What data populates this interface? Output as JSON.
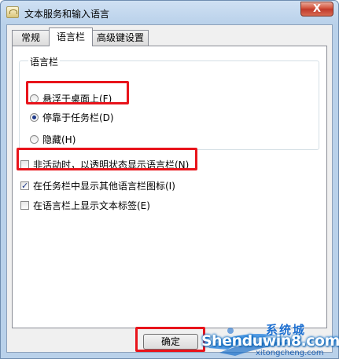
{
  "window": {
    "title": "文本服务和输入语言",
    "close_label": "X"
  },
  "tabs": [
    {
      "label": "常规",
      "active": false
    },
    {
      "label": "语言栏",
      "active": true
    },
    {
      "label": "高级键设置",
      "active": false
    }
  ],
  "language_bar_group": {
    "label": "语言栏",
    "options": [
      {
        "label": "悬浮于桌面上(F)",
        "selected": false
      },
      {
        "label": "停靠于任务栏(D)",
        "selected": true
      },
      {
        "label": "隐藏(H)",
        "selected": false
      }
    ]
  },
  "checkboxes": [
    {
      "label": "非活动时，以透明状态显示语言栏(N)",
      "checked": false
    },
    {
      "label": "在任务栏中显示其他语言栏图标(I)",
      "checked": true
    },
    {
      "label": "在语言栏上显示文本标签(E)",
      "checked": false
    }
  ],
  "buttons": {
    "ok_label": "确定"
  },
  "watermark": {
    "top_text": "系统城",
    "main_text": "Shenduwin8.com",
    "sub_text": "xitongcheng.com"
  },
  "colors": {
    "highlight": "#e8141b",
    "title_bg": "#b9d1ea",
    "close": "#c0392b"
  }
}
